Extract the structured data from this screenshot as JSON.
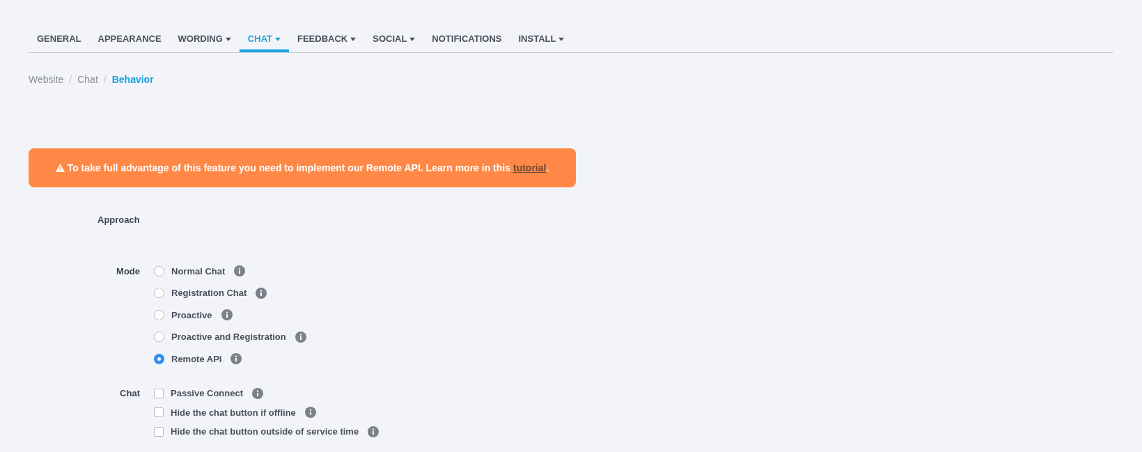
{
  "tabs": [
    {
      "label": "GENERAL",
      "dropdown": false,
      "selected": false
    },
    {
      "label": "APPEARANCE",
      "dropdown": false,
      "selected": false
    },
    {
      "label": "WORDING",
      "dropdown": true,
      "selected": false
    },
    {
      "label": "CHAT",
      "dropdown": true,
      "selected": true
    },
    {
      "label": "FEEDBACK",
      "dropdown": true,
      "selected": false
    },
    {
      "label": "SOCIAL",
      "dropdown": true,
      "selected": false
    },
    {
      "label": "NOTIFICATIONS",
      "dropdown": false,
      "selected": false
    },
    {
      "label": "INSTALL",
      "dropdown": true,
      "selected": false
    }
  ],
  "breadcrumb": [
    {
      "label": "Website",
      "current": false
    },
    {
      "label": "Chat",
      "current": false
    },
    {
      "label": "Behavior",
      "current": true
    }
  ],
  "breadcrumb_separator": "/",
  "alert": {
    "text": "To take full advantage of this feature you need to implement our Remote API. Learn more in this",
    "link": "tutorial",
    "end": "."
  },
  "section_title": "Approach",
  "mode": {
    "label": "Mode",
    "options": [
      {
        "label": "Normal Chat",
        "selected": false
      },
      {
        "label": "Registration Chat",
        "selected": false
      },
      {
        "label": "Proactive",
        "selected": false
      },
      {
        "label": "Proactive and Registration",
        "selected": false
      },
      {
        "label": "Remote API",
        "selected": true
      }
    ]
  },
  "chat": {
    "label": "Chat",
    "options": [
      {
        "label": "Passive Connect",
        "checked": false
      },
      {
        "label": "Hide the chat button if offline",
        "checked": false
      },
      {
        "label": "Hide the chat button outside of service time",
        "checked": false
      }
    ]
  }
}
